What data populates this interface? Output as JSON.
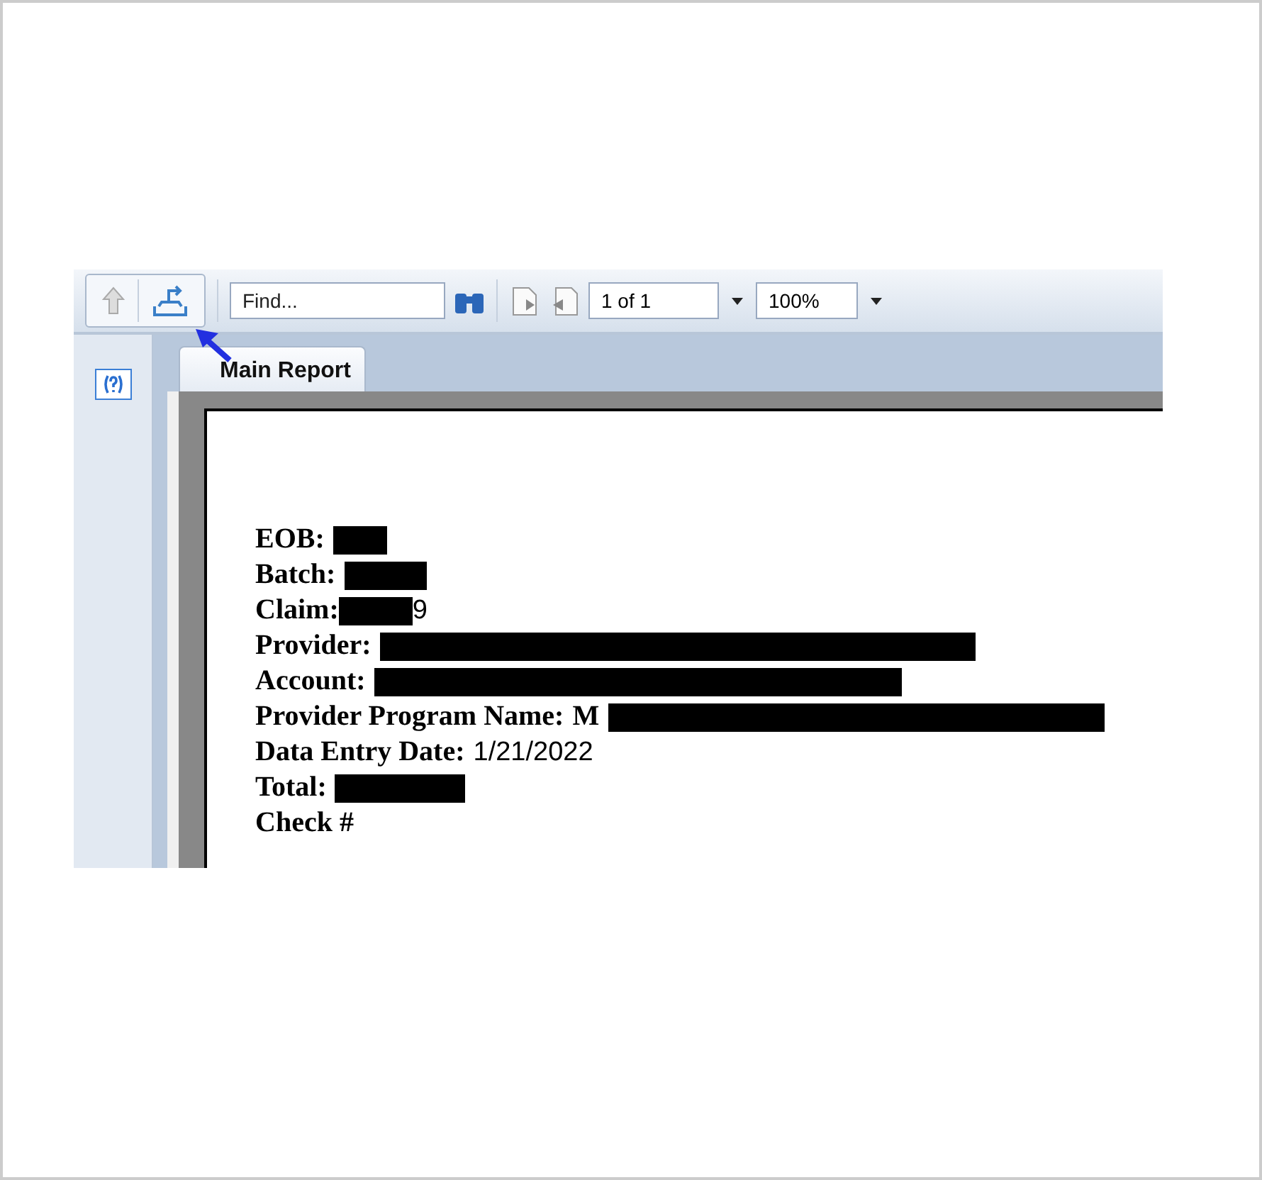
{
  "toolbar": {
    "find": {
      "placeholder": "Find..."
    },
    "page": {
      "value": "1 of 1"
    },
    "zoom": {
      "value": "100%"
    }
  },
  "tabs": [
    {
      "label": "Main Report",
      "selected": true
    }
  ],
  "report": {
    "fields": [
      {
        "label": "EOB:",
        "parts": [
          {
            "kind": "redaction"
          }
        ]
      },
      {
        "label": "Batch:",
        "parts": [
          {
            "kind": "redaction"
          }
        ]
      },
      {
        "label": "Claim:",
        "parts": [
          {
            "kind": "redaction"
          },
          {
            "kind": "text",
            "text": "9"
          }
        ]
      },
      {
        "label": "Provider:",
        "parts": [
          {
            "kind": "redaction"
          }
        ]
      },
      {
        "label": "Account:",
        "parts": [
          {
            "kind": "redaction"
          }
        ]
      },
      {
        "label": "Provider Program Name:",
        "parts": [
          {
            "kind": "text",
            "text": "M"
          },
          {
            "kind": "redaction"
          }
        ]
      },
      {
        "label": "Data Entry Date:",
        "parts": [
          {
            "kind": "text",
            "text": "1/21/2022"
          }
        ]
      },
      {
        "label": "Total:",
        "parts": [
          {
            "kind": "redaction"
          }
        ]
      },
      {
        "label": "Check #"
      }
    ]
  }
}
